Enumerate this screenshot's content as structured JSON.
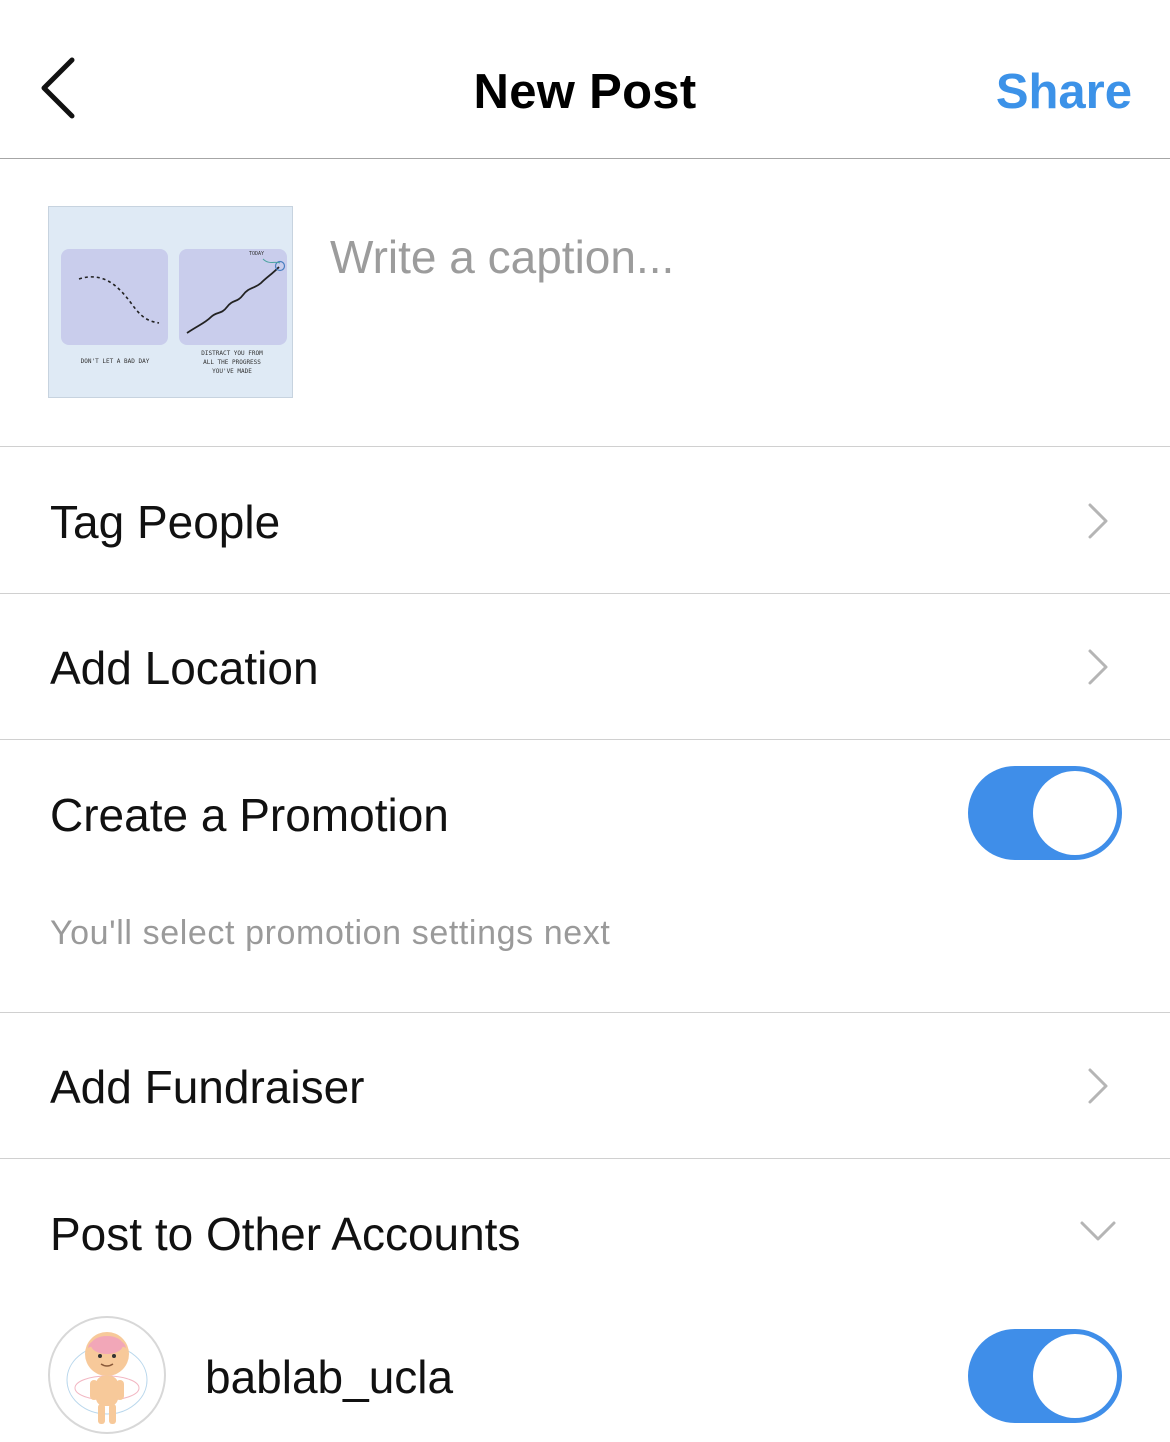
{
  "header": {
    "title": "New Post",
    "share_label": "Share",
    "back_icon": "chevron-left-icon"
  },
  "caption": {
    "placeholder": "Write a caption...",
    "value": ""
  },
  "thumbnail": {
    "left_caption": "DON'T LET A BAD DAY",
    "right_caption_line1": "DISTRACT YOU FROM",
    "right_caption_line2": "ALL THE PROGRESS",
    "right_caption_line3": "YOU'VE MADE",
    "today_label": "TODAY"
  },
  "rows": {
    "tag_people": "Tag People",
    "add_location": "Add Location",
    "create_promotion": "Create a Promotion",
    "promotion_note": "You'll select promotion settings next",
    "add_fundraiser": "Add Fundraiser",
    "post_other_accounts": "Post to Other Accounts"
  },
  "toggles": {
    "create_promotion_on": true,
    "account_on": true
  },
  "account": {
    "username": "bablab_ucla"
  },
  "colors": {
    "accent": "#3c92e8",
    "toggle_on": "#3f8ee9",
    "secondary_text": "#9a9a9a"
  }
}
